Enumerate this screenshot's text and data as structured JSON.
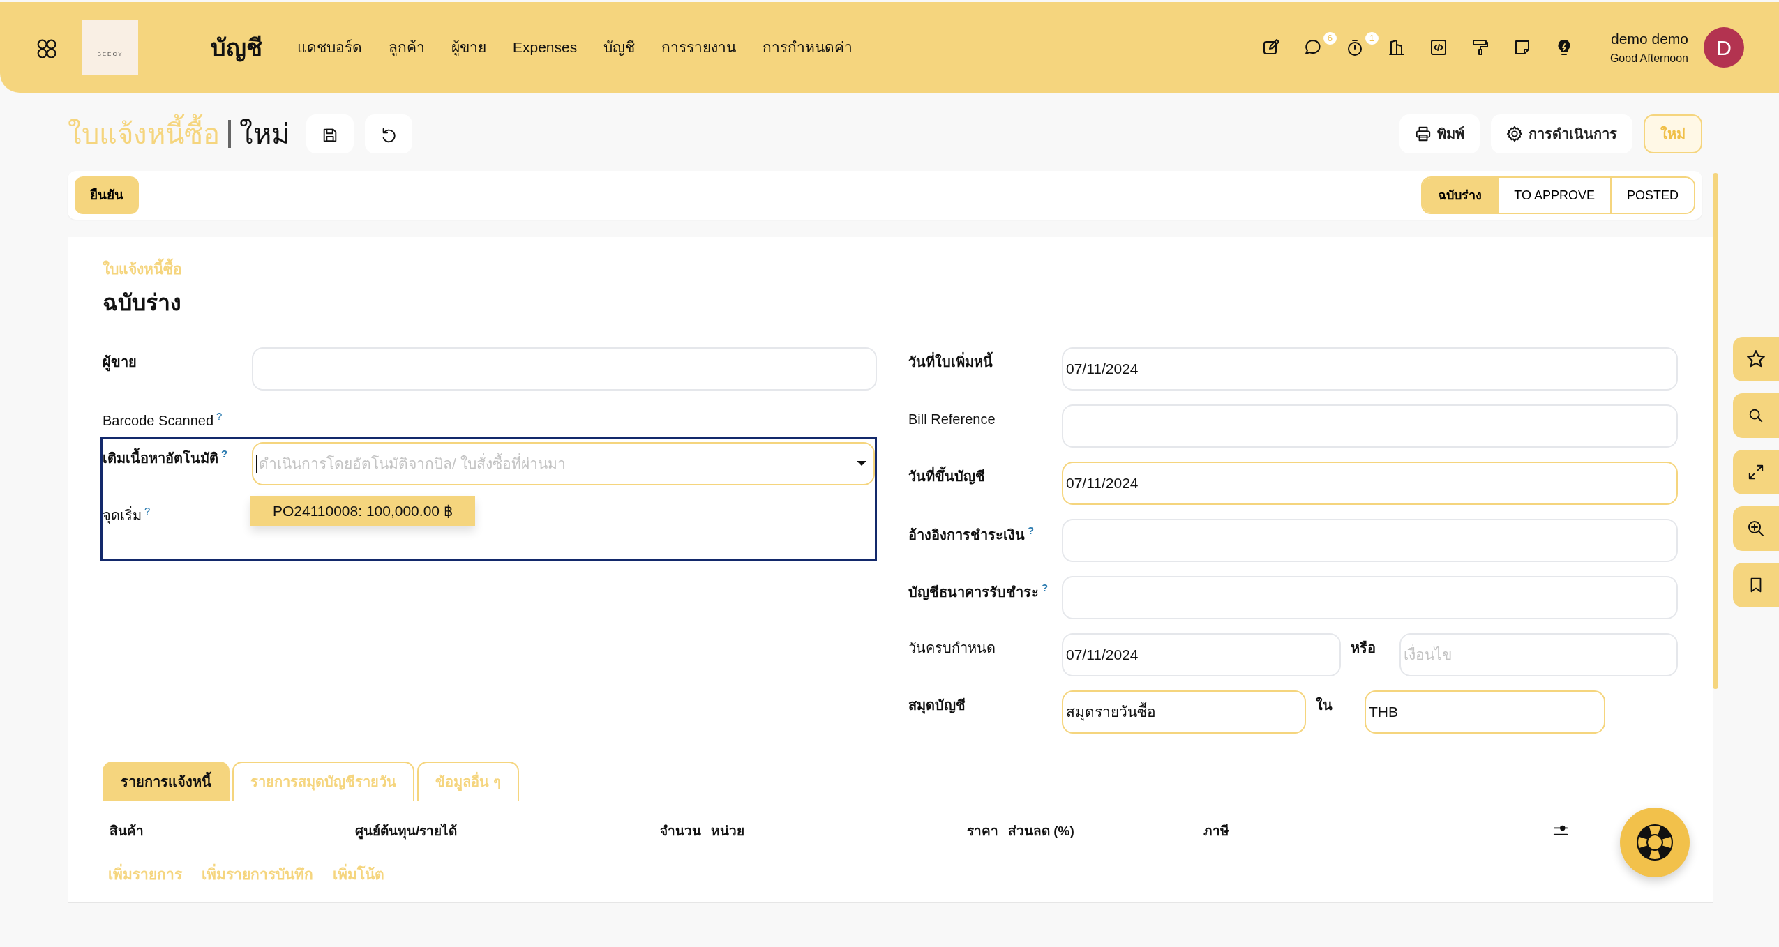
{
  "app": {
    "name": "บัญชี",
    "logo_text": "BEECY"
  },
  "nav": [
    "แดชบอร์ด",
    "ลูกค้า",
    "ผู้ขาย",
    "Expenses",
    "บัญชี",
    "การรายงาน",
    "การกำหนดค่า"
  ],
  "header_icons": [
    {
      "kind": "edit"
    },
    {
      "kind": "chat",
      "badge": "6"
    },
    {
      "kind": "timer",
      "badge": "1"
    },
    {
      "kind": "building"
    },
    {
      "kind": "code"
    },
    {
      "kind": "roller"
    },
    {
      "kind": "note"
    },
    {
      "kind": "bulb"
    }
  ],
  "user": {
    "name": "demo demo",
    "greeting": "Good Afternoon",
    "avatar": "D"
  },
  "breadcrumb": {
    "parent": "ใบแจ้งหนี้ซื้อ",
    "current": "ใหม่"
  },
  "actions": {
    "print": "พิมพ์",
    "operations": "การดำเนินการ",
    "new": "ใหม่"
  },
  "confirm_button": "ยืนยัน",
  "statuses": [
    {
      "label": "ฉบับร่าง",
      "selected": true
    },
    {
      "label": "TO APPROVE",
      "selected": false
    },
    {
      "label": "POSTED",
      "selected": false
    }
  ],
  "form": {
    "type_label": "ใบแจ้งหนี้ซื้อ",
    "title": "ฉบับร่าง",
    "left_fields": [
      {
        "kind": "input",
        "label": "ผู้ขาย",
        "emphasized": true,
        "required": false
      },
      {
        "kind": "label",
        "label": "Barcode Scanned",
        "help": "?",
        "emphasized": false
      },
      {
        "kind": "autocomplete",
        "label": "เติมเนื้อหาอัตโนมัติ",
        "help": "?",
        "emphasized": true,
        "required": true,
        "placeholder": "ดำเนินการโดยอัตโนมัติจากบิล/ ใบสั่งซื้อที่ผ่านมา",
        "suggestion": "PO24110008: 100,000.00 ฿",
        "focused": true
      },
      {
        "kind": "label",
        "label": "จุดเริ่ม",
        "help": "?",
        "emphasized": false
      }
    ],
    "right_fields": [
      {
        "kind": "input",
        "label": "วันที่ใบเพิ่มหนี้",
        "emphasized": true,
        "required": false,
        "value": "07/11/2024"
      },
      {
        "kind": "input",
        "label": "Bill Reference",
        "emphasized": false,
        "required": false
      },
      {
        "kind": "input",
        "label": "วันที่ขึ้นบัญชี",
        "emphasized": true,
        "required": true,
        "value": "07/11/2024"
      },
      {
        "kind": "input",
        "label": "อ้างอิงการชำระเงิน",
        "help": "?",
        "emphasized": true,
        "required": false
      },
      {
        "kind": "input",
        "label": "บัญชีธนาคารรับชำระ",
        "help": "?",
        "emphasized": true,
        "required": false
      },
      {
        "kind": "pair",
        "label": "วันครบกำหนด",
        "emphasized": false,
        "required": false,
        "value": "07/11/2024",
        "second_label": "หรือ",
        "second_placeholder": "เงื่อนไข",
        "second_required": false
      },
      {
        "kind": "pair",
        "label": "สมุดบัญชี",
        "emphasized": true,
        "required": true,
        "value": "สมุดรายวันซื้อ",
        "second_label": "ใน",
        "second_value": "THB",
        "second_required": true
      }
    ]
  },
  "line_tabs": [
    {
      "label": "รายการแจ้งหนี้",
      "selected": true
    },
    {
      "label": "รายการสมุดบัญชีรายวัน",
      "selected": false
    },
    {
      "label": "ข้อมูลอื่น ๆ",
      "selected": false
    }
  ],
  "table": {
    "columns": [
      "สินค้า",
      "ศูนย์ต้นทุน/รายได้",
      "จำนวน",
      "หน่วย",
      "ราคา",
      "ส่วนลด (%)",
      "ภาษี"
    ]
  },
  "add_links": [
    "เพิ่มรายการ",
    "เพิ่มรายการบันทึก",
    "เพิ่มโน้ต"
  ],
  "side_tools": [
    {
      "kind": "star"
    },
    {
      "kind": "search"
    },
    {
      "kind": "expand"
    },
    {
      "kind": "zoom"
    },
    {
      "kind": "bookmark"
    }
  ]
}
